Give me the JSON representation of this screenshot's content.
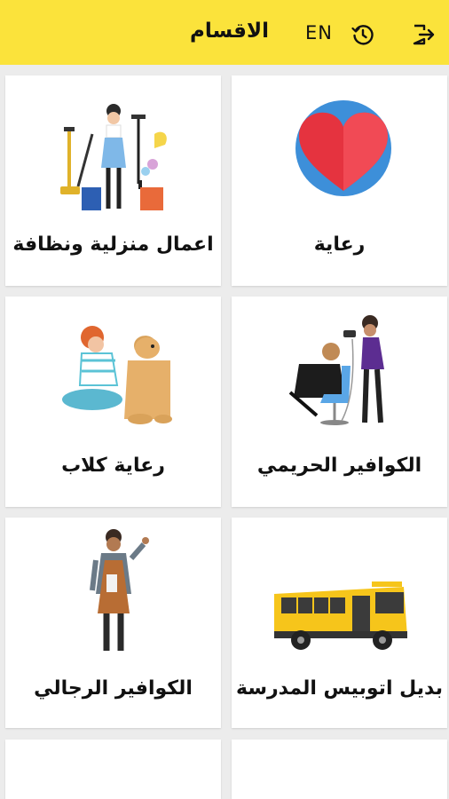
{
  "header": {
    "title": "الاقسام",
    "lang_button": "EN",
    "history_icon": "history-icon",
    "logout_icon": "logout-icon",
    "background_color": "#fbe33b"
  },
  "categories": [
    {
      "label": "رعاية",
      "icon": "heart-icon"
    },
    {
      "label": "اعمال منزلية ونظافة",
      "icon": "cleaning-woman-icon"
    },
    {
      "label": "الكوافير الحريمي",
      "icon": "women-hairdresser-icon"
    },
    {
      "label": "رعاية كلاب",
      "icon": "dog-care-icon"
    },
    {
      "label": "بديل اتوبيس المدرسة",
      "icon": "school-bus-icon"
    },
    {
      "label": "الكوافير الرجالي",
      "icon": "barber-icon"
    }
  ]
}
